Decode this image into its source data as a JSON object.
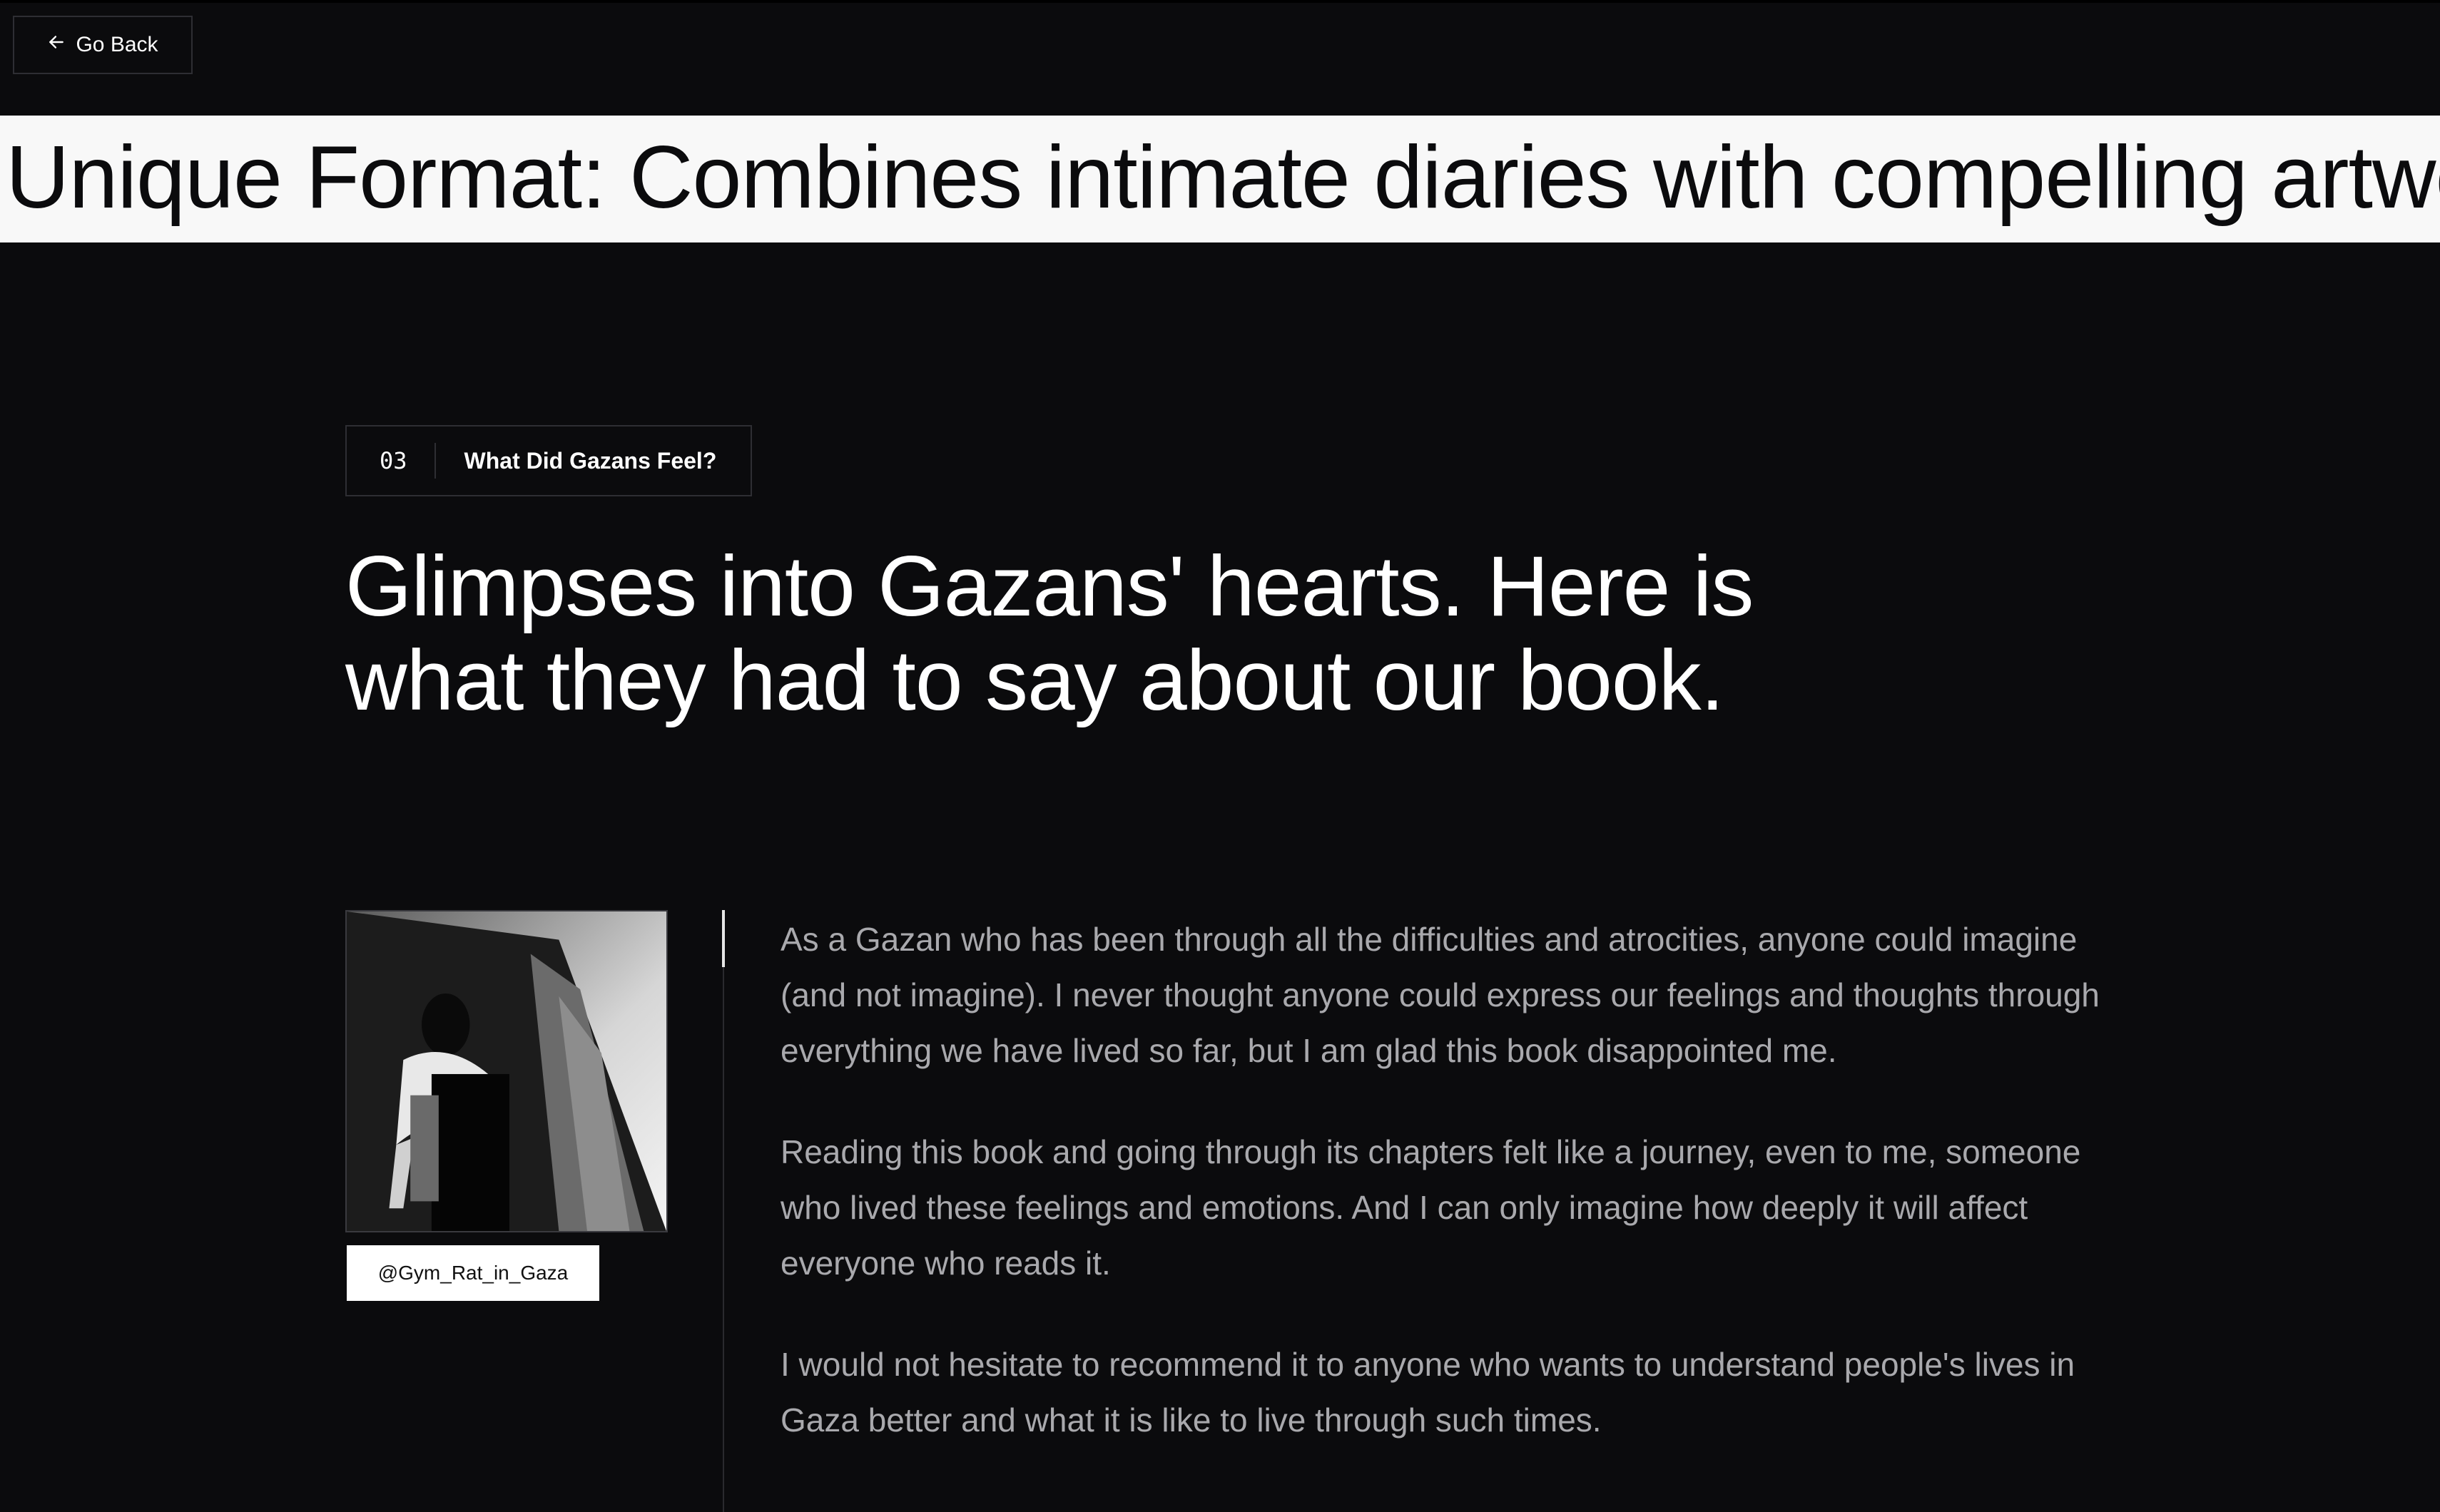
{
  "nav": {
    "back_label": "Go Back",
    "back_icon": "arrow-left-icon"
  },
  "marquee": {
    "text": "Unique Format: Combines intimate diaries with compelling artwo"
  },
  "section": {
    "number": "03",
    "label": "What Did Gazans Feel?",
    "headline_line1": "Glimpses into Gazans' hearts. Here is",
    "headline_line2": "what they had to say about our book."
  },
  "testimonial": {
    "handle": "@Gym_Rat_in_Gaza",
    "photo": "black-and-white portrait photo",
    "paragraphs": [
      "As a Gazan who has been through all the difficulties and atrocities, anyone could imagine (and not imagine). I never thought anyone could express our feelings and thoughts through everything we have lived so far, but I am glad this book disappointed me.",
      "Reading this book and going through its chapters felt like a journey, even to me, someone who lived these feelings and emotions. And I can only imagine how deeply it will affect everyone who reads it.",
      "I would not hesitate to recommend it to anyone who wants to understand people's lives in Gaza better and what it is like to live through such times."
    ]
  },
  "colors": {
    "background": "#0b0b0d",
    "marquee_bg": "#f8f8f8",
    "review_text": "#a9a9ad",
    "border": "#2e2e33"
  }
}
